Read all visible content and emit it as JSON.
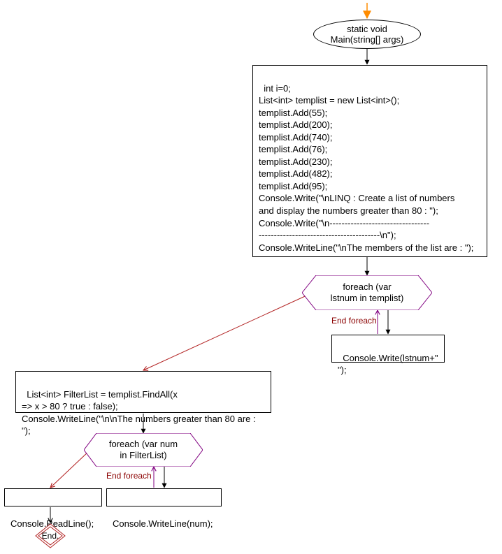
{
  "nodes": {
    "start_ellipse": "static void\nMain(string[] args)",
    "init_block": "int i=0;\nList<int> templist = new List<int>();\ntemplist.Add(55);\ntemplist.Add(200);\ntemplist.Add(740);\ntemplist.Add(76);\ntemplist.Add(230);\ntemplist.Add(482);\ntemplist.Add(95);\nConsole.Write(\"\\nLINQ : Create a list of numbers\nand display the numbers greater than 80 : \");\nConsole.Write(\"\\n---------------------------------\n----------------------------------------\\n\");\nConsole.WriteLine(\"\\nThe members of the list are : \");",
    "foreach1": "foreach (var\nlstnum in templist)",
    "foreach1_body": "Console.Write(lstnum+\"\n\");",
    "filter_block": "List<int> FilterList = templist.FindAll(x\n=> x > 80 ? true : false);\nConsole.WriteLine(\"\\n\\nThe numbers greater than 80 are : \");",
    "foreach2": "foreach (var num\nin FilterList)",
    "foreach2_body": "Console.WriteLine(num);",
    "readline": "Console.ReadLine();",
    "end": "End."
  },
  "labels": {
    "end_foreach1": "End foreach",
    "end_foreach2": "End foreach"
  },
  "colors": {
    "arrow_black": "#000000",
    "arrow_orange": "#FF8C00",
    "arrow_red": "#B22222",
    "arrow_purple": "#800080",
    "hex_purple": "#800080",
    "end_red": "#B22222",
    "end_label": "#8b0000"
  }
}
